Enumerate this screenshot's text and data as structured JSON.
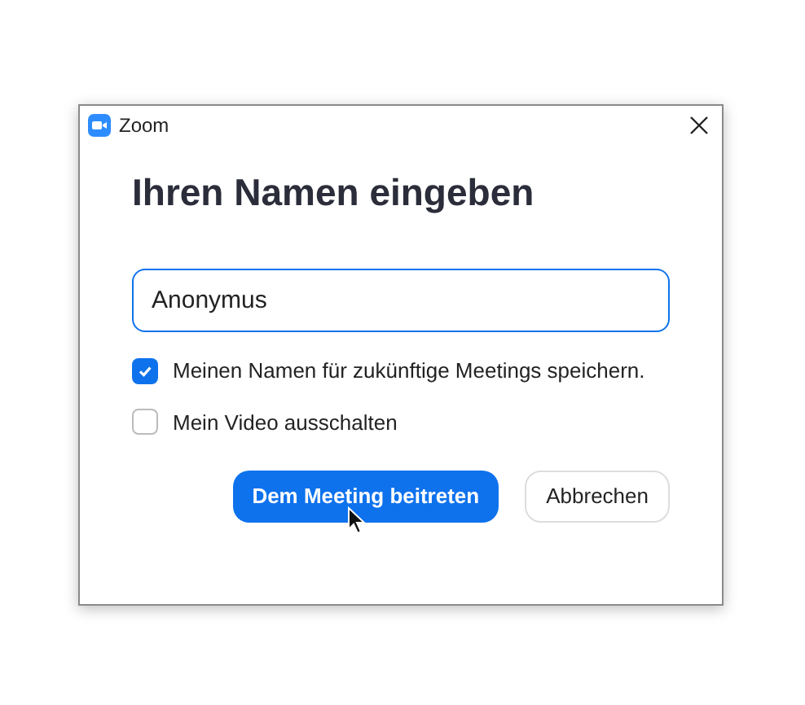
{
  "window": {
    "title": "Zoom"
  },
  "heading": "Ihren Namen eingeben",
  "name_field": {
    "value": "Anonymus"
  },
  "options": [
    {
      "label": "Meinen Namen für zukünftige Meetings speichern.",
      "checked": true
    },
    {
      "label": "Mein Video ausschalten",
      "checked": false
    }
  ],
  "buttons": [
    {
      "label": "Dem Meeting beitreten",
      "kind": "primary"
    },
    {
      "label": "Abbrechen",
      "kind": "secondary"
    }
  ]
}
